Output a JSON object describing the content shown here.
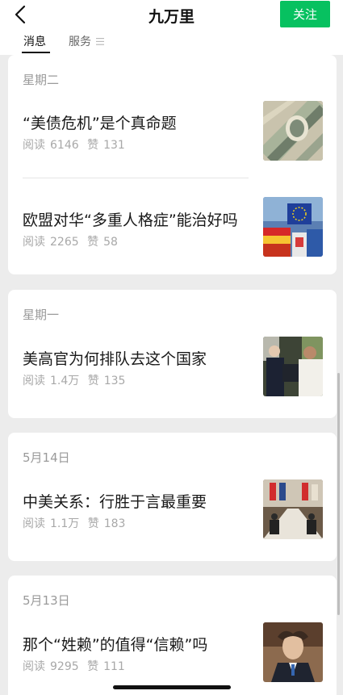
{
  "header": {
    "title": "九万里",
    "follow_label": "关注",
    "tabs": [
      {
        "label": "消息"
      },
      {
        "label": "服务"
      }
    ]
  },
  "groups": [
    {
      "label": "星期二",
      "articles": [
        {
          "title": "“美债危机”是个真命题",
          "read_label": "阅读",
          "reads": "6146",
          "like_label": "赞",
          "likes": "131",
          "thumb": "dollar-bills-image"
        },
        {
          "title": "欧盟对华“多重人格症”能治好吗",
          "read_label": "阅读",
          "reads": "2265",
          "like_label": "赞",
          "likes": "58",
          "thumb": "eu-flags-image"
        }
      ]
    },
    {
      "label": "星期一",
      "articles": [
        {
          "title": "美高官为何排队去这个国家",
          "read_label": "阅读",
          "reads": "1.4万",
          "like_label": "赞",
          "likes": "135",
          "thumb": "officials-meeting-image"
        }
      ]
    },
    {
      "label": "5月14日",
      "articles": [
        {
          "title": "中美关系：行胜于言最重要",
          "read_label": "阅读",
          "reads": "1.1万",
          "like_label": "赞",
          "likes": "183",
          "thumb": "conference-table-image"
        }
      ]
    },
    {
      "label": "5月13日",
      "articles": [
        {
          "title": "那个“姓赖”的值得“信赖”吗",
          "read_label": "阅读",
          "reads": "9295",
          "like_label": "赞",
          "likes": "111",
          "thumb": "man-portrait-image"
        }
      ]
    }
  ],
  "colors": {
    "accent": "#07c160",
    "background": "#ececec",
    "muted_text": "#a8a8a8"
  }
}
